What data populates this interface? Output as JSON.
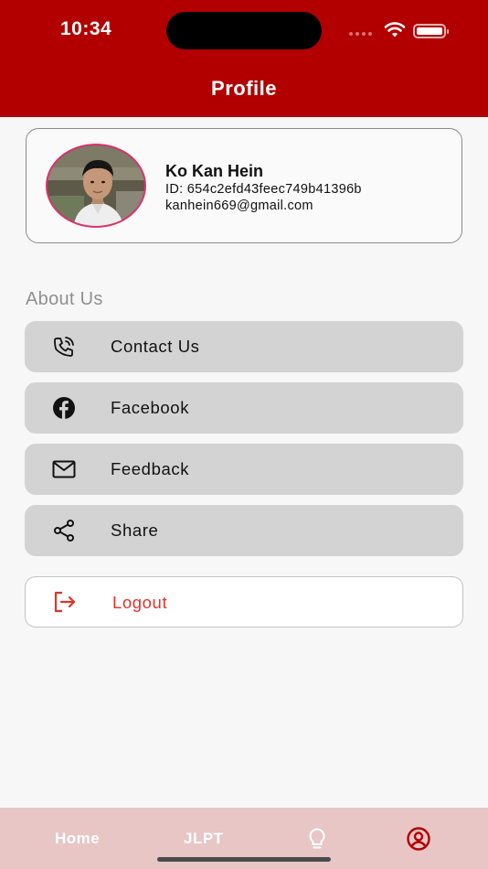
{
  "status_bar": {
    "time": "10:34"
  },
  "header": {
    "title": "Profile"
  },
  "profile": {
    "name": "Ko Kan Hein",
    "id_line": "ID: 654c2efd43feec749b41396b",
    "email": "kanhein669@gmail.com"
  },
  "about": {
    "section_title": "About Us",
    "items": [
      {
        "label": "Contact Us",
        "icon": "phone-icon"
      },
      {
        "label": "Facebook",
        "icon": "facebook-icon"
      },
      {
        "label": "Feedback",
        "icon": "mail-icon"
      },
      {
        "label": "Share",
        "icon": "share-icon"
      }
    ]
  },
  "logout": {
    "label": "Logout",
    "icon": "logout-icon"
  },
  "bottom_nav": {
    "items": [
      {
        "label": "Home"
      },
      {
        "label": "JLPT"
      },
      {
        "icon": "lightbulb-icon"
      },
      {
        "icon": "account-icon",
        "active": true
      }
    ]
  },
  "colors": {
    "header": "#b20000",
    "logout": "#e0342a",
    "nav_background": "#e8c6c6",
    "avatar_border": "#e0306e"
  }
}
